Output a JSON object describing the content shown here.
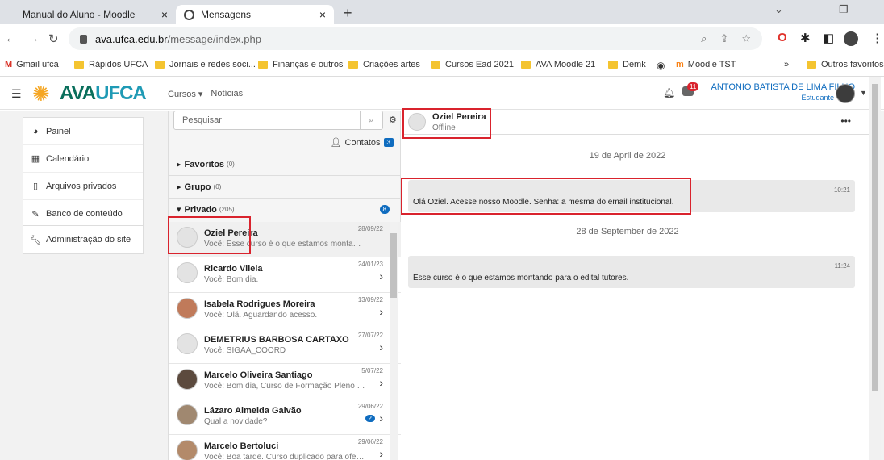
{
  "browser": {
    "tabs": [
      {
        "label": "Manual do Aluno - Moodle",
        "close": "×"
      },
      {
        "label": "Mensagens",
        "close": "×"
      }
    ],
    "new_tab": "+",
    "url_host": "ava.ufca.edu.br",
    "url_path": "/message/index.php",
    "bookmarks": [
      {
        "label": "Gmail ufca",
        "icon": "gmail-icon"
      },
      {
        "label": "Rápidos UFCA",
        "icon": "folder-icon"
      },
      {
        "label": "Jornais e redes soci...",
        "icon": "folder-icon"
      },
      {
        "label": "Finanças e outros",
        "icon": "folder-icon"
      },
      {
        "label": "Criações artes",
        "icon": "folder-icon"
      },
      {
        "label": "Cursos Ead 2021",
        "icon": "folder-icon"
      },
      {
        "label": "AVA Moodle 21",
        "icon": "folder-icon"
      },
      {
        "label": "Demk",
        "icon": "folder-icon"
      },
      {
        "label": "Moodle TST",
        "icon": "moodle-icon"
      }
    ],
    "bookmarks_more": "»",
    "other_bookmarks": "Outros favoritos"
  },
  "header": {
    "logo_ava": "AVA",
    "logo_ufca": "UFCA",
    "menu": [
      "Cursos ▾",
      "Notícias"
    ],
    "notif_count": "11",
    "user_name": "ANTONIO BATISTA DE LIMA FILHO",
    "user_role": "Estudante"
  },
  "sidebar": {
    "items": [
      {
        "label": "Painel",
        "icon": "dashboard-icon"
      },
      {
        "label": "Calendário",
        "icon": "calendar-icon"
      },
      {
        "label": "Arquivos privados",
        "icon": "file-icon"
      },
      {
        "label": "Banco de conteúdo",
        "icon": "brush-icon"
      }
    ],
    "admin": {
      "label": "Administração do site",
      "icon": "wrench-icon"
    }
  },
  "messages": {
    "search_placeholder": "Pesquisar",
    "contacts_label": "Contatos",
    "contacts_count": "3",
    "favorites": {
      "label": "Favoritos",
      "count": "(0)"
    },
    "group": {
      "label": "Grupo",
      "count": "(0)"
    },
    "private": {
      "label": "Privado",
      "count": "(205)",
      "badge": "8"
    },
    "conversations": [
      {
        "name": "Oziel Pereira",
        "preview": "Você: Esse curso é o que estamos montando pa...",
        "date": "28/09/22",
        "unread": ""
      },
      {
        "name": "Ricardo Vilela",
        "preview": "Você: Bom dia.",
        "date": "24/01/23",
        "unread": ""
      },
      {
        "name": "Isabela Rodrigues Moreira",
        "preview": "Você: Olá. Aguardando acesso.",
        "date": "13/09/22",
        "unread": ""
      },
      {
        "name": "DEMETRIUS BARBOSA CARTAXO",
        "preview": "Você: SIGAA_COORD",
        "date": "27/07/22",
        "unread": ""
      },
      {
        "name": "Marcelo Oliveira Santiago",
        "preview": "Você: Bom dia, Curso de Formação Pleno do PA...",
        "date": "5/07/22",
        "unread": ""
      },
      {
        "name": "Lázaro Almeida Galvão",
        "preview": "Qual a novidade?",
        "date": "29/06/22",
        "unread": "2"
      },
      {
        "name": "Marcelo Bertoluci",
        "preview": "Você: Boa tarde. Curso duplicado para oferta e...",
        "date": "29/06/22",
        "unread": ""
      }
    ]
  },
  "chat": {
    "contact_name": "Oziel Pereira",
    "contact_status": "Offline",
    "days": [
      {
        "date": "19 de April de 2022",
        "message": {
          "text": "Olá Oziel. Acesse nosso Moodle. Senha: a mesma do email institucional.",
          "time": "10:21"
        }
      },
      {
        "date": "28 de September de 2022",
        "message": {
          "text": "Esse curso é o que estamos montando para o edital tutores.",
          "time": "11:24"
        }
      }
    ]
  },
  "colors": {
    "accent": "#0f6cbf",
    "highlight_box": "#d9232d"
  }
}
